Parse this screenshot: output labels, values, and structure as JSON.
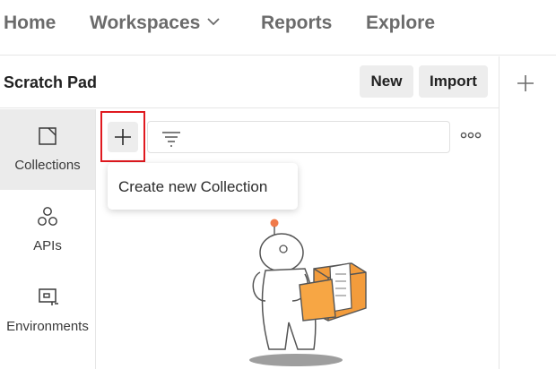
{
  "nav": {
    "home": "Home",
    "workspaces": "Workspaces",
    "reports": "Reports",
    "explore": "Explore"
  },
  "header": {
    "title": "Scratch Pad",
    "new_label": "New",
    "import_label": "Import"
  },
  "sidebar": {
    "items": [
      {
        "label": "Collections",
        "icon": "collections-icon",
        "active": true
      },
      {
        "label": "APIs",
        "icon": "apis-icon",
        "active": false
      },
      {
        "label": "Environments",
        "icon": "environments-icon",
        "active": false
      }
    ]
  },
  "toolbar": {
    "search_value": "",
    "tooltip": "Create new Collection"
  },
  "colors": {
    "highlight_border": "#e0191f",
    "illustration_orange": "#f39c3c"
  }
}
